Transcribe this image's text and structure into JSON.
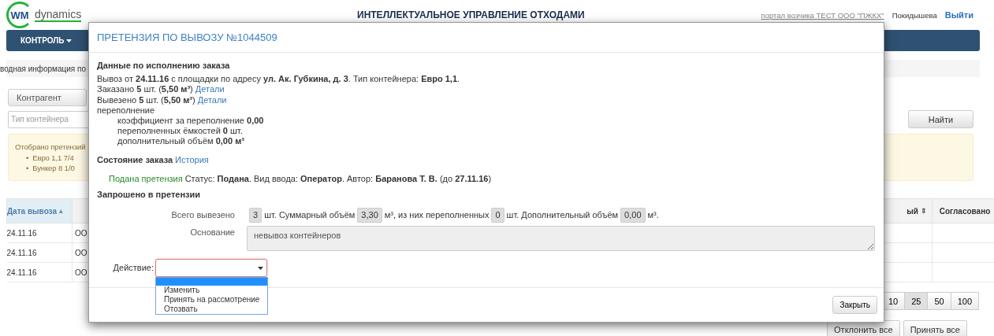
{
  "header": {
    "logo_mark": "WM",
    "logo_text": "dynamics",
    "title": "ИНТЕЛЛЕКТУАЛЬНОЕ УПРАВЛЕНИЕ ОТХОДАМИ",
    "portal": "портал возчика ТЕСТ ООО \"ПЖКХ\"",
    "user": "Покидышева",
    "logout": "Выйти"
  },
  "nav": [
    {
      "label": "КОНТРОЛЬ",
      "has_caret": true
    }
  ],
  "breadcrumb": "водная информация по",
  "filters": {
    "contractor": "Контрагент",
    "container_type_placeholder": "Тип контейнера",
    "search_button": "Найти"
  },
  "alert": {
    "text": "Отобрано претензий",
    "bullet": "•",
    "items": [
      "Евро 1,1 7/4",
      "Бункер 8 1/0"
    ]
  },
  "table": {
    "columns": [
      {
        "label": "Дата вывоза",
        "sort_icon": "▴"
      },
      {
        "label": "ый",
        "sort_icon": "⇕"
      },
      {
        "label": "Согласовано"
      }
    ],
    "rows": [
      {
        "date": "24.11.16",
        "column_2": "ОО"
      },
      {
        "date": "24.11.16",
        "column_2": "ОО"
      },
      {
        "date": "24.11.16",
        "column_2": "ОО"
      }
    ]
  },
  "pagination": [
    {
      "label": "10",
      "selected": false
    },
    {
      "label": "25",
      "selected": true
    },
    {
      "label": "50",
      "selected": false
    },
    {
      "label": "100",
      "selected": false
    }
  ],
  "bulk_buttons": [
    "Отклонить все",
    "Принять все"
  ],
  "modal": {
    "title": "ПРЕТЕНЗИЯ ПО ВЫВОЗУ №1044509",
    "execution": {
      "heading": "Данные по исполнению заказа",
      "lines": [
        {
          "text": "Вывоз от **24.11.16** с площадки по адресу **ул. Ак. Губкина, д. 3**. Тип контейнера: **Евро 1,1**.",
          "indent": false
        },
        {
          "text": "Заказано **5** шт. (**5,50 м³**)",
          "link": "Детали",
          "indent": false
        },
        {
          "text": "Вывезено **5** шт. (**5,50 м³**)",
          "link": "Детали",
          "indent": false
        },
        {
          "text": "переполнение",
          "indent": false
        },
        {
          "text": "коэффициент за переполнение **0,00**",
          "indent": true
        },
        {
          "text": "переполненных ёмкостей **0** шт.",
          "indent": true
        },
        {
          "text": "дополнительный объём **0,00 м³**",
          "indent": true
        }
      ]
    },
    "state": {
      "heading": "Состояние заказа",
      "link": "История",
      "status_label": "Подана претензия",
      "status_text": "Статус: **Подана**. Вид ввода: **Оператор**. Автор: **Баранова Т. В.** (до **27.11.16**)"
    },
    "requested": {
      "heading": "Запрошено в претензии",
      "total_label": "Всего вывезено",
      "parts": [
        {
          "kind": "box",
          "text": "3"
        },
        {
          "kind": "text",
          "text": "шт. Суммарный объём"
        },
        {
          "kind": "box",
          "text": "3,30"
        },
        {
          "kind": "text",
          "text": "м³, из них переполненных"
        },
        {
          "kind": "box",
          "text": "0"
        },
        {
          "kind": "text",
          "text": "шт. Дополнительный объём"
        },
        {
          "kind": "box",
          "text": "0,00"
        },
        {
          "kind": "text",
          "text": "м³."
        }
      ],
      "reason_label": "Основание",
      "reason": "невывоз контейнеров"
    },
    "action": {
      "label": "Действие:",
      "open": true,
      "blank_highlighted": true,
      "options": [
        "Изменить",
        "Принять на рассмотрение",
        "Отозвать"
      ]
    },
    "close_button": "Закрыть"
  }
}
